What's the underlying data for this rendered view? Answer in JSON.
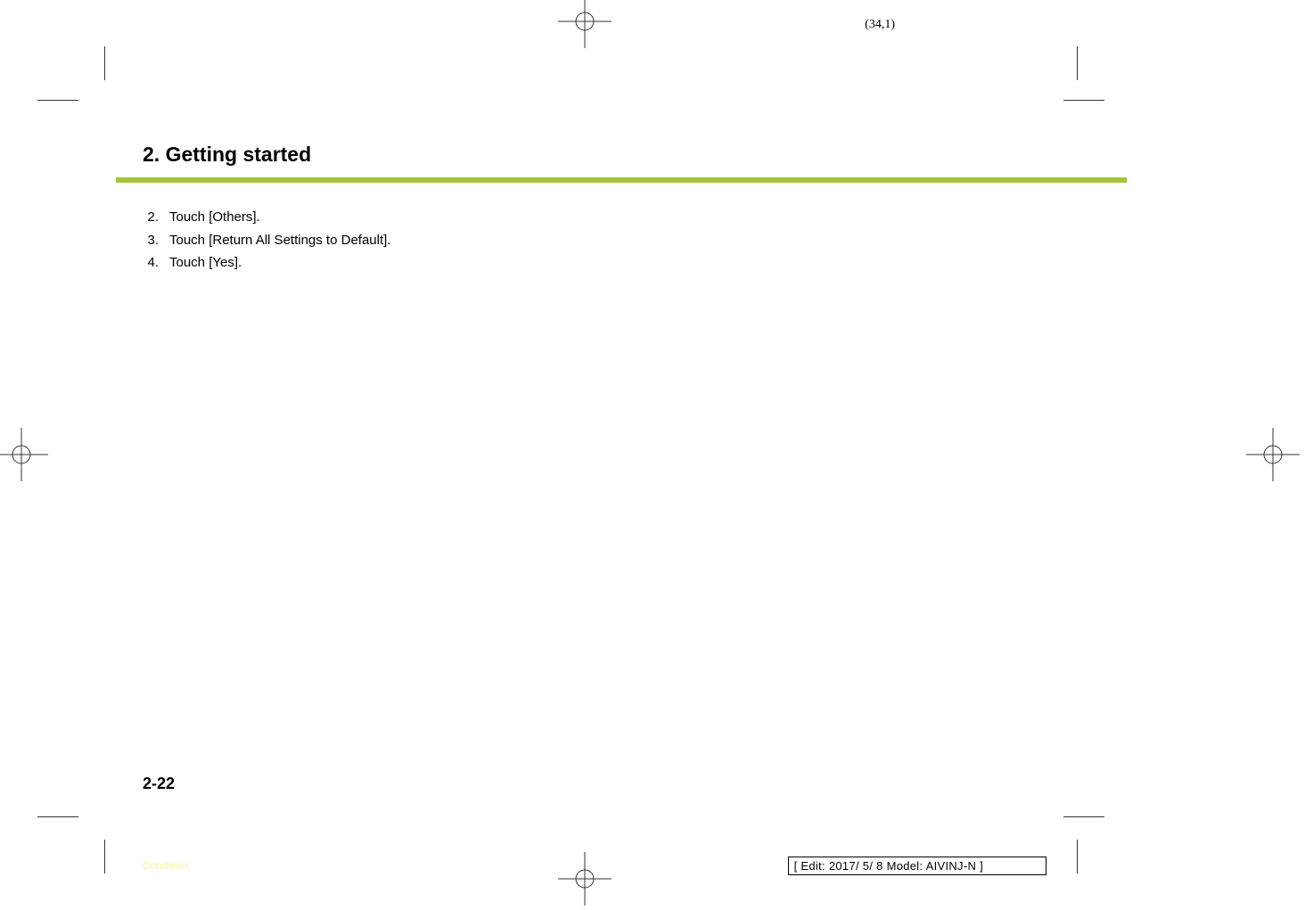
{
  "page_coord": "(34,1)",
  "section_title": "2. Getting started",
  "steps": [
    {
      "num": "2.",
      "text": "Touch [Others]."
    },
    {
      "num": "3.",
      "text": "Touch [Return All Settings to Default]."
    },
    {
      "num": "4.",
      "text": "Touch [Yes]."
    }
  ],
  "page_number": "2-22",
  "footer_left": "Condition:",
  "footer_right": "[ Edit: 2017/ 5/ 8   Model: AIVINJ-N ]"
}
